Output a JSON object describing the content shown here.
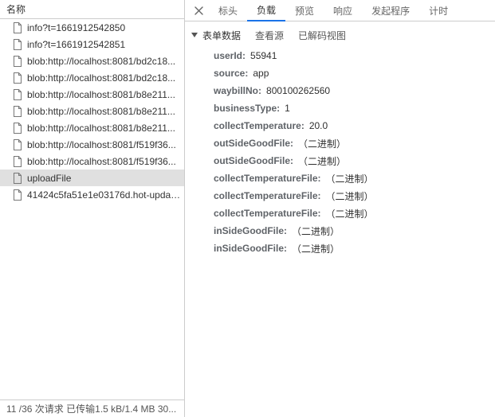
{
  "leftHeader": "名称",
  "requests": [
    {
      "name": "info?t=1661912542850",
      "selected": false
    },
    {
      "name": "info?t=1661912542851",
      "selected": false
    },
    {
      "name": "blob:http://localhost:8081/bd2c18...",
      "selected": false
    },
    {
      "name": "blob:http://localhost:8081/bd2c18...",
      "selected": false
    },
    {
      "name": "blob:http://localhost:8081/b8e211...",
      "selected": false
    },
    {
      "name": "blob:http://localhost:8081/b8e211...",
      "selected": false
    },
    {
      "name": "blob:http://localhost:8081/b8e211...",
      "selected": false
    },
    {
      "name": "blob:http://localhost:8081/f519f36...",
      "selected": false
    },
    {
      "name": "blob:http://localhost:8081/f519f36...",
      "selected": false
    },
    {
      "name": "uploadFile",
      "selected": true
    },
    {
      "name": "41424c5fa51e1e03176d.hot-updat...",
      "selected": false
    }
  ],
  "footer": "11 /36 次请求  已传输1.5 kB/1.4 MB  30...",
  "tabs": [
    {
      "label": "标头",
      "active": false
    },
    {
      "label": "负载",
      "active": true
    },
    {
      "label": "预览",
      "active": false
    },
    {
      "label": "响应",
      "active": false
    },
    {
      "label": "发起程序",
      "active": false
    },
    {
      "label": "计时",
      "active": false
    }
  ],
  "section": {
    "title": "表单数据",
    "viewSource": "查看源",
    "decoded": "已解码视图"
  },
  "formData": [
    {
      "key": "userId",
      "value": "55941"
    },
    {
      "key": "source",
      "value": "app"
    },
    {
      "key": "waybillNo",
      "value": "800100262560"
    },
    {
      "key": "businessType",
      "value": "1"
    },
    {
      "key": "collectTemperature",
      "value": "20.0"
    },
    {
      "key": "outSideGoodFile",
      "value": "（二进制）"
    },
    {
      "key": "outSideGoodFile",
      "value": "（二进制）"
    },
    {
      "key": "collectTemperatureFile",
      "value": "（二进制）"
    },
    {
      "key": "collectTemperatureFile",
      "value": "（二进制）"
    },
    {
      "key": "collectTemperatureFile",
      "value": "（二进制）"
    },
    {
      "key": "inSideGoodFile",
      "value": "（二进制）"
    },
    {
      "key": "inSideGoodFile",
      "value": "（二进制）"
    }
  ]
}
